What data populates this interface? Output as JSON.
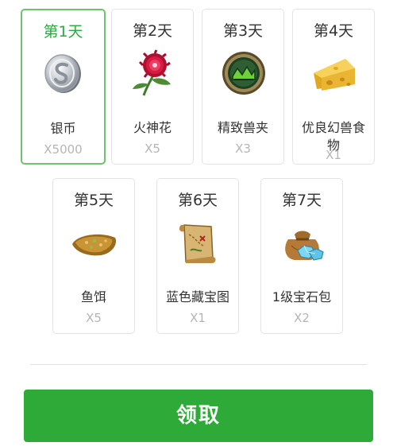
{
  "rewards": [
    {
      "day": "第1天",
      "name": "银币",
      "qty": "X5000",
      "icon": "silver-coin-icon"
    },
    {
      "day": "第2天",
      "name": "火神花",
      "qty": "X5",
      "icon": "red-flower-icon"
    },
    {
      "day": "第3天",
      "name": "精致兽夹",
      "qty": "X3",
      "icon": "beast-trap-icon"
    },
    {
      "day": "第4天",
      "name": "优良幻兽食物",
      "qty": "X1",
      "icon": "cheese-icon"
    },
    {
      "day": "第5天",
      "name": "鱼饵",
      "qty": "X5",
      "icon": "fish-bait-icon"
    },
    {
      "day": "第6天",
      "name": "蓝色藏宝图",
      "qty": "X1",
      "icon": "treasure-map-icon"
    },
    {
      "day": "第7天",
      "name": "1级宝石包",
      "qty": "X2",
      "icon": "gem-bag-icon"
    }
  ],
  "claim_button": {
    "label": "领取"
  },
  "colors": {
    "accent": "#2eaa39",
    "selected_border": "#6cc36c",
    "selected_day": "#2ea83c"
  }
}
